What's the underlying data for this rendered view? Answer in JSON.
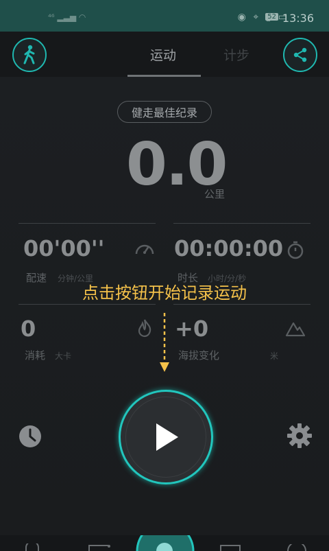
{
  "status_bar": {
    "time": "13:36",
    "battery": "52"
  },
  "tabs": [
    {
      "label": "运动"
    },
    {
      "label": "计步"
    }
  ],
  "record_pill": "健走最佳纪录",
  "distance": {
    "value": "0.0",
    "unit": "公里"
  },
  "stats": {
    "pace": {
      "value": "00'00''",
      "label": "配速",
      "unit": "分钟/公里"
    },
    "duration": {
      "value": "00:00:00",
      "label": "时长",
      "unit": "小时/分/秒"
    },
    "calories": {
      "value": "0",
      "label": "消耗",
      "unit": "大卡"
    },
    "elevation": {
      "value": "+0",
      "label": "海拔变化",
      "unit": "米"
    }
  },
  "prompt": "点击按钮开始记录运动",
  "colors": {
    "accent": "#22c6bd",
    "prompt": "#f5c24a",
    "status_bar": "#1f4f4a"
  }
}
